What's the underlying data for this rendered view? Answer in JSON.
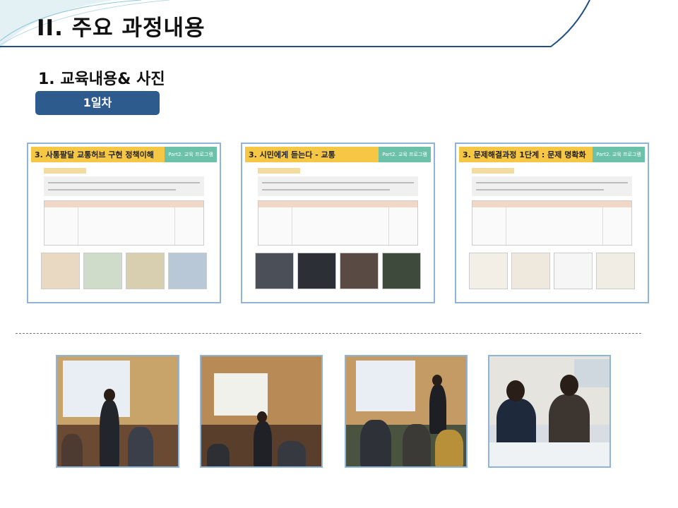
{
  "page": {
    "main_title": "II. 주요 과정내용",
    "section_title": "1. 교육내용& 사진",
    "day_badge": "1일차"
  },
  "slides": [
    {
      "title": "3. 사통팔달 교통허브 구현 정책이해",
      "tag": "Part2. 교육 프로그램"
    },
    {
      "title": "3. 시민에게 듣는다 - 교통",
      "tag": "Part2. 교육 프로그램"
    },
    {
      "title": "3. 문제해결과정 1단계 : 문제 명확화",
      "tag": "Part2. 교육 프로그램"
    }
  ],
  "colors": {
    "accent_navy": "#2e5b8e",
    "slide_header_yellow": "#f6c744",
    "slide_tag_green": "#6cc2a9",
    "frame_blue": "#8fb4d8"
  }
}
